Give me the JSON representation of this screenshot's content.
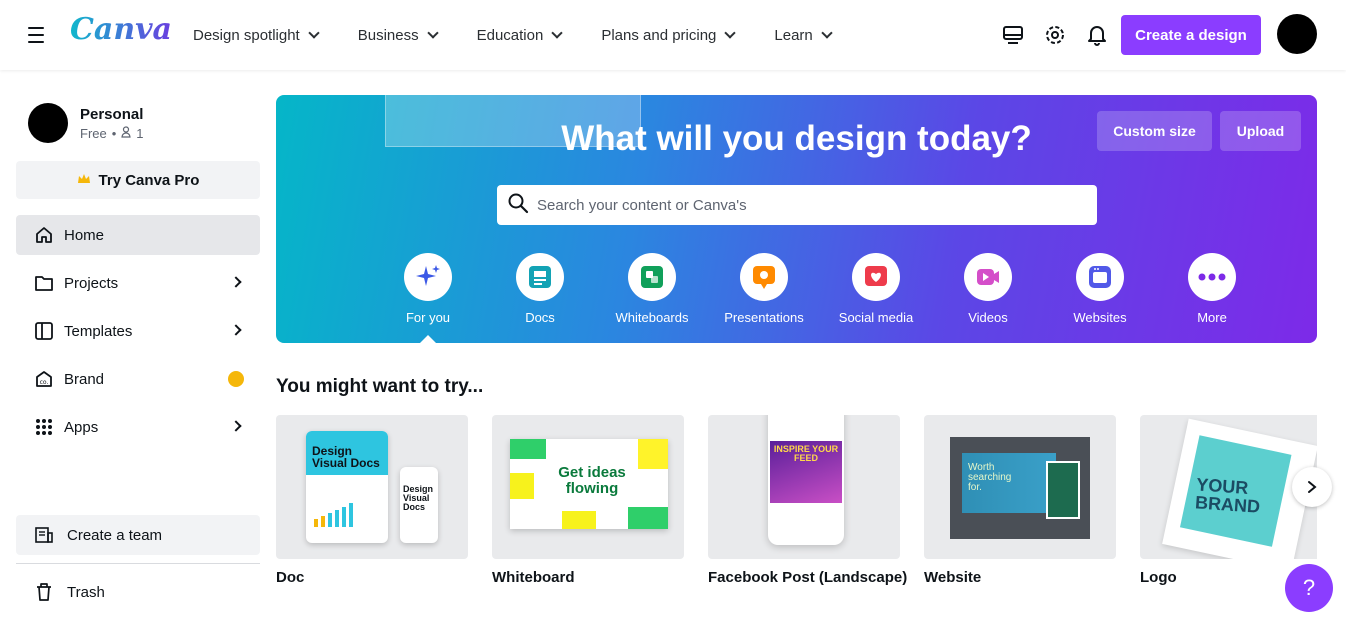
{
  "header": {
    "logo": "Canva",
    "nav": [
      "Design spotlight",
      "Business",
      "Education",
      "Plans and pricing",
      "Learn"
    ],
    "icons": [
      "desktop-icon",
      "gear-icon",
      "bell-icon"
    ],
    "create_label": "Create a design"
  },
  "sidebar": {
    "account_name": "Personal",
    "account_plan": "Free",
    "account_members": "1",
    "try_pro": "Try Canva Pro",
    "items": [
      {
        "label": "Home",
        "icon": "home-icon"
      },
      {
        "label": "Projects",
        "icon": "folder-icon"
      },
      {
        "label": "Templates",
        "icon": "templates-icon"
      },
      {
        "label": "Brand",
        "icon": "brand-icon"
      },
      {
        "label": "Apps",
        "icon": "apps-icon"
      }
    ],
    "create_team": "Create a team",
    "trash": "Trash"
  },
  "hero": {
    "title": "What will you design today?",
    "custom_size": "Custom size",
    "upload": "Upload",
    "search_placeholder": "Search your content or Canva's",
    "categories": [
      {
        "label": "For you",
        "color": "#3c59e6"
      },
      {
        "label": "Docs",
        "color": "#13a3b5"
      },
      {
        "label": "Whiteboards",
        "color": "#10a05a"
      },
      {
        "label": "Presentations",
        "color": "#ff8a00"
      },
      {
        "label": "Social media",
        "color": "#ee3b4b"
      },
      {
        "label": "Videos",
        "color": "#d44ec9"
      },
      {
        "label": "Websites",
        "color": "#5159e8"
      },
      {
        "label": "More",
        "color": "#7d2ae8"
      }
    ]
  },
  "suggestions": {
    "title": "You might want to try...",
    "cards": [
      "Doc",
      "Whiteboard",
      "Facebook Post (Landscape)",
      "Website",
      "Logo"
    ],
    "thumb_text": {
      "doc_big": "Design Visual Docs",
      "doc_small": "Design Visual Docs",
      "whiteboard": "Get ideas flowing",
      "facebook": "INSPIRE YOUR FEED",
      "website": "Worth searching for.",
      "logo": "YOUR BRAND"
    }
  },
  "help": "?",
  "colors": {
    "accent": "#8b3dff",
    "hero_start": "#05b6c8",
    "hero_end": "#7d2ae8"
  }
}
